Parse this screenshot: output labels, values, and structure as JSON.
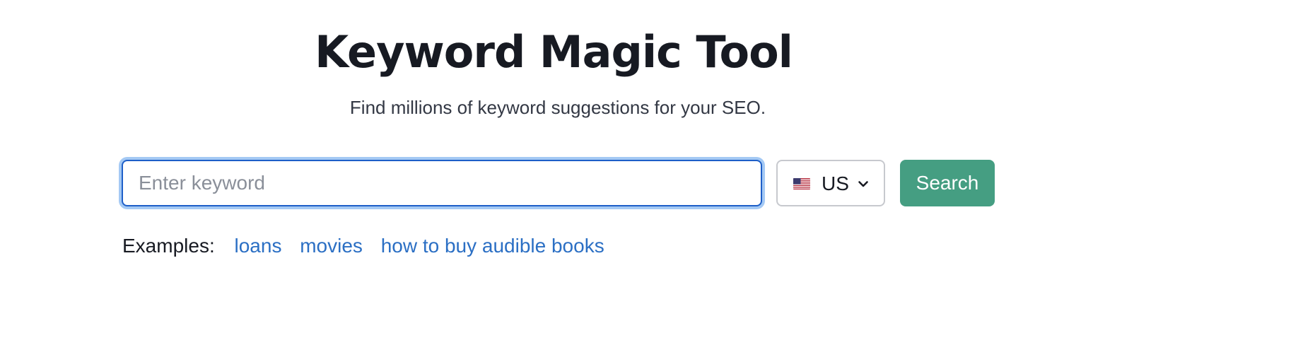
{
  "header": {
    "title": "Keyword Magic Tool",
    "subtitle": "Find millions of keyword suggestions for your SEO."
  },
  "search": {
    "placeholder": "Enter keyword",
    "value": ""
  },
  "database_select": {
    "selected": "US",
    "flag_icon": "us-flag-icon"
  },
  "search_button": {
    "label": "Search"
  },
  "examples": {
    "label": "Examples:",
    "items": [
      "loans",
      "movies",
      "how to buy audible books"
    ]
  },
  "colors": {
    "input_border": "#1e5fc8",
    "input_focus_ring": "#a4c9f4",
    "search_button": "#459e82",
    "link": "#2b6fc4",
    "title": "#171a22"
  }
}
